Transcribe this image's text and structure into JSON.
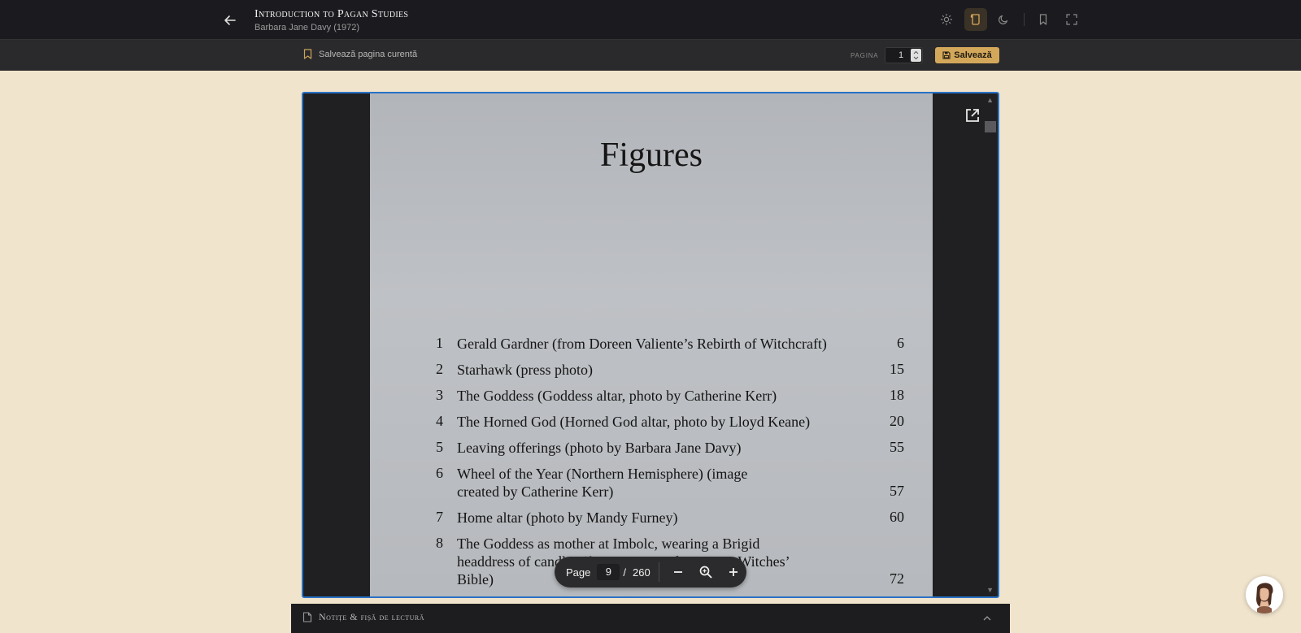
{
  "topbar": {
    "title": "Introduction to Pagan Studies",
    "author": "Barbara Jane Davy (1972)",
    "icons": [
      "back-arrow-icon",
      "sun-icon",
      "scroll-icon",
      "moon-icon",
      "bookmark-icon",
      "fullscreen-icon"
    ]
  },
  "subbar": {
    "save_current_label": "Salvează pagina curentă",
    "page_label": "PAGINA",
    "page_value": "1",
    "save_button_label": "Salvează"
  },
  "document": {
    "heading": "Figures",
    "figures": [
      {
        "num": "1",
        "text": "Gerald Gardner (from Doreen Valiente’s Rebirth of Witchcraft)",
        "page": "6"
      },
      {
        "num": "2",
        "text": "Starhawk (press photo)",
        "page": "15"
      },
      {
        "num": "3",
        "text": "The Goddess (Goddess altar, photo by Catherine Kerr)",
        "page": "18"
      },
      {
        "num": "4",
        "text": "The Horned God (Horned God altar, photo by Lloyd Keane)",
        "page": "20"
      },
      {
        "num": "5",
        "text": "Leaving offerings (photo by Barbara Jane Davy)",
        "page": "55"
      },
      {
        "num": "6",
        "text": "Wheel of the Year (Northern Hemisphere) (image created by Catherine Kerr)",
        "page": "57"
      },
      {
        "num": "7",
        "text": "Home altar (photo by Mandy Furney)",
        "page": "60"
      },
      {
        "num": "8",
        "text": "The Goddess as mother at Imbolc, wearing a Brigid headdress of candles (from Farrar and Farrar, A Witches’ Bible)",
        "page": "72"
      }
    ]
  },
  "viewer_toolbar": {
    "page_label": "Page",
    "current_page": "9",
    "separator": "/",
    "total_pages": "260"
  },
  "notes": {
    "title": "Notițe & fișă de lectură"
  }
}
